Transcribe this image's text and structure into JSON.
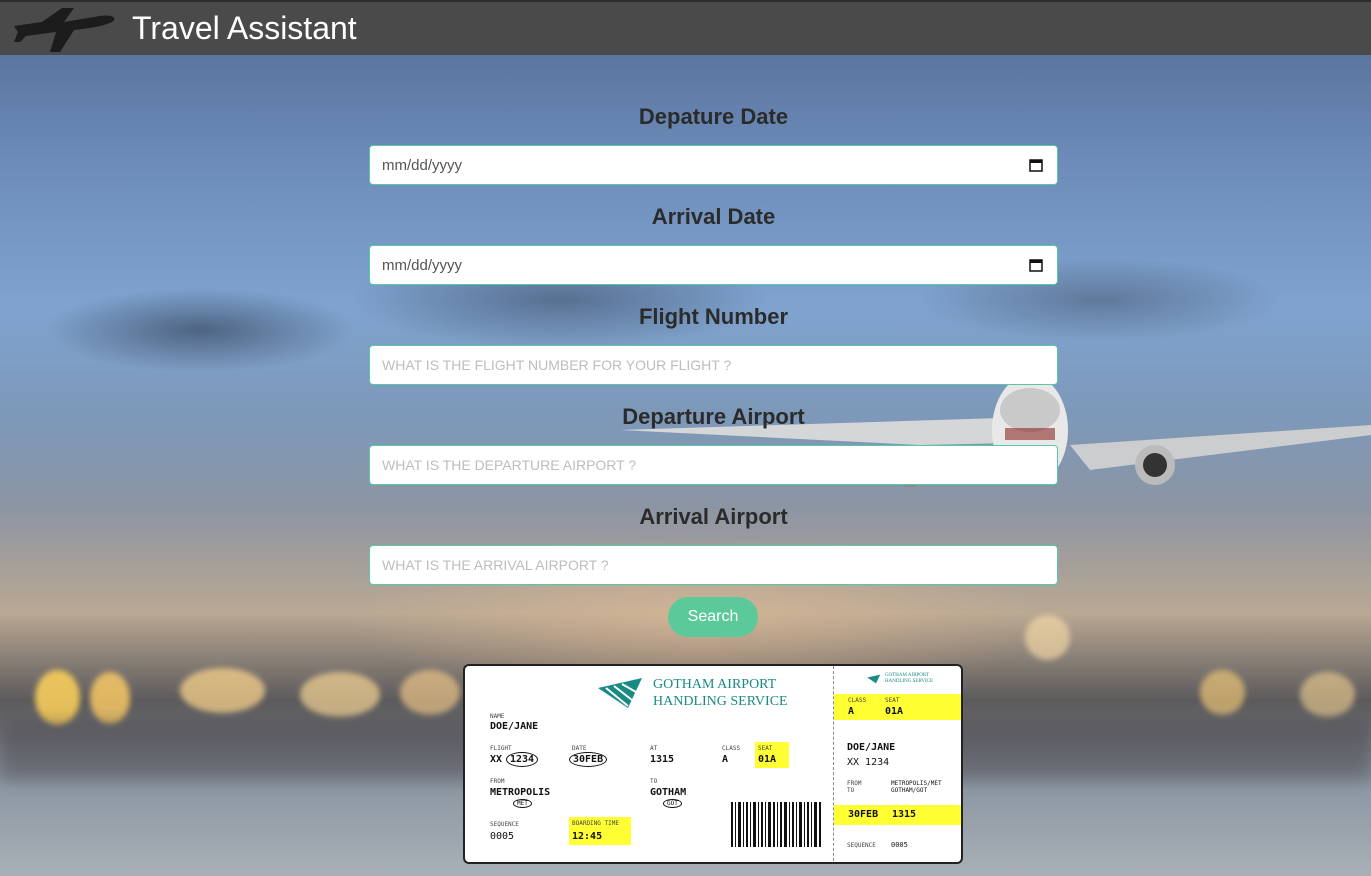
{
  "header": {
    "title": "Travel Assistant",
    "logo_icon": "airplane-icon"
  },
  "form": {
    "departure_date": {
      "label": "Depature Date",
      "value": "mm/dd/yyyy",
      "icon": "calendar-icon"
    },
    "arrival_date": {
      "label": "Arrival Date",
      "value": "mm/dd/yyyy",
      "icon": "calendar-icon"
    },
    "flight_number": {
      "label": "Flight Number",
      "placeholder": "WHAT IS THE FLIGHT NUMBER FOR YOUR FLIGHT ?"
    },
    "departure_airport": {
      "label": "Departure Airport",
      "placeholder": "WHAT IS THE DEPARTURE AIRPORT ?"
    },
    "arrival_airport": {
      "label": "Arrival Airport",
      "placeholder": "WHAT IS THE ARRIVAL AIRPORT ?"
    },
    "search_label": "Search"
  },
  "ticket": {
    "brand_line1": "GOTHAM AIRPORT",
    "brand_line2": "HANDLING SERVICE",
    "stub_brand_line1": "GOTHAM AIRPORT",
    "stub_brand_line2": "HANDLING SERVICE",
    "name_label": "NAME",
    "name": "DOE/JANE",
    "flight_label": "FLIGHT",
    "flight_prefix": "XX",
    "flight_number": "1234",
    "date_label": "DATE",
    "date": "30FEB",
    "at_label": "AT",
    "at": "1315",
    "class_label": "CLASS",
    "class": "A",
    "seat_label": "SEAT",
    "seat": "01A",
    "from_label": "FROM",
    "from": "METROPOLIS",
    "from_code": "MET",
    "to_label": "TO",
    "to": "GOTHAM",
    "to_code": "GOT",
    "sequence_label": "SEQUENCE",
    "sequence": "0005",
    "boarding_time_label": "BOARDING TIME",
    "boarding_time": "12:45",
    "stub": {
      "class_label": "CLASS",
      "seat_label": "SEAT",
      "class": "A",
      "seat": "01A",
      "name": "DOE/JANE",
      "flight": "XX 1234",
      "from_label": "FROM",
      "to_label": "TO",
      "from_to": "METROPOLIS/MET",
      "from_to_2": "GOTHAM/GOT",
      "date": "30FEB",
      "time": "1315",
      "sequence_label": "SEQUENCE",
      "sequence": "0005"
    }
  },
  "colors": {
    "header_bg": "#4a4a4a",
    "accent": "#56c7a7",
    "button": "#5bc99a",
    "highlight": "#ffff33"
  }
}
